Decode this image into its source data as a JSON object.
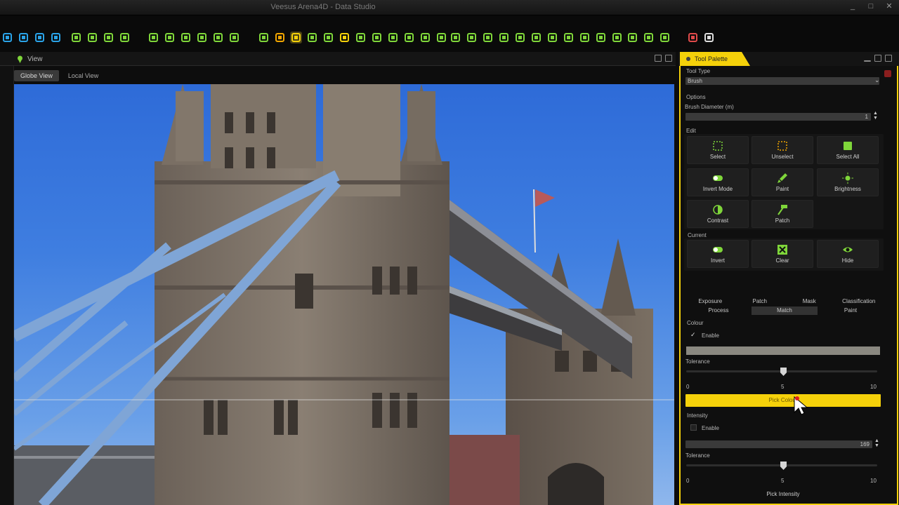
{
  "window": {
    "title": "Veesus Arena4D - Data Studio",
    "controls": [
      "_",
      "□",
      "✕"
    ]
  },
  "toolbar": {
    "icons": [
      "new-icon",
      "camera-icon",
      "document-icon",
      "share-icon",
      "link-icon",
      "save-icon",
      "export-icon",
      "import-icon",
      "map-icon",
      "layers-icon",
      "stack-icon",
      "chart-icon",
      "clock-icon",
      "globe-icon",
      "measure-icon",
      "hand-icon",
      "pencil-icon",
      "grid-icon",
      "table-icon",
      "sun-icon",
      "zoom-icon",
      "help-icon",
      "world-icon",
      "cloud-icon",
      "move-icon",
      "bar-icon",
      "person-icon",
      "video-icon",
      "network-icon",
      "target-icon",
      "pin-icon",
      "eye-icon",
      "refresh-icon",
      "rotate-icon",
      "walk-icon",
      "up-icon",
      "up2-icon",
      "redo-icon",
      "tile-icon",
      "tile2-icon",
      "tile3-icon",
      "hand2-icon"
    ],
    "accent": "#7fd63a"
  },
  "view": {
    "tab_label": "View",
    "subtabs": [
      "Globe View",
      "Local View"
    ],
    "active_subtab": "Globe View"
  },
  "palette": {
    "tab_label": "Tool Palette",
    "accent": "#f5d10a",
    "tool_type_label": "Tool Type",
    "tool_type_value": "Brush",
    "options_label": "Options",
    "brush_diameter_label": "Brush Diameter (m)",
    "brush_diameter_value": "1",
    "edit_label": "Edit",
    "edit_buttons": [
      "Select",
      "Unselect",
      "Select All",
      "Invert Mode",
      "Paint",
      "Brightness",
      "Contrast",
      "Patch"
    ],
    "current_label": "Current",
    "current_buttons": [
      "Invert",
      "Clear",
      "Hide"
    ],
    "tabs_row1": [
      "Exposure",
      "Patch",
      "Mask",
      "Classification"
    ],
    "tabs_row2": [
      "Process",
      "Match",
      "Paint"
    ],
    "active_tab": "Match",
    "colour": {
      "label": "Colour",
      "enable_label": "Enable",
      "enabled": true,
      "tolerance_label": "Tolerance",
      "tolerance_value": 5,
      "min": "0",
      "mid": "5",
      "max": "10",
      "pick_button": "Pick Colour"
    },
    "intensity": {
      "label": "Intensity",
      "enable_label": "Enable",
      "enabled": false,
      "value": "169",
      "tolerance_label": "Tolerance",
      "tolerance_value": 5,
      "min": "0",
      "mid": "5",
      "max": "10",
      "pick_button": "Pick Intensity"
    }
  }
}
